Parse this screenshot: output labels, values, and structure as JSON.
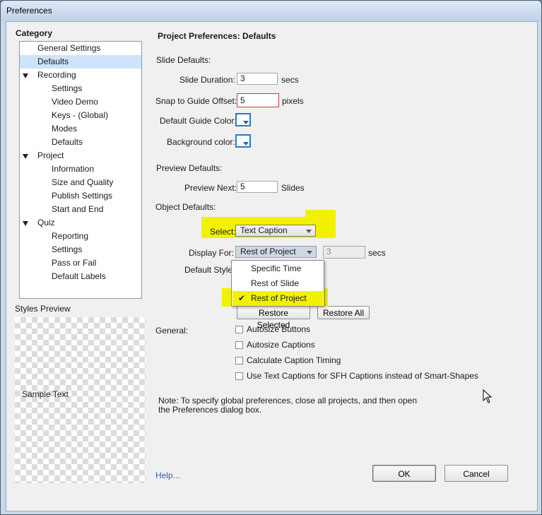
{
  "window": {
    "title": "Preferences"
  },
  "category": {
    "heading": "Category",
    "items": [
      {
        "label": "General Settings"
      },
      {
        "label": "Defaults"
      },
      {
        "label": "Recording"
      },
      {
        "label": "Settings"
      },
      {
        "label": "Video Demo"
      },
      {
        "label": "Keys - (Global)"
      },
      {
        "label": "Modes"
      },
      {
        "label": "Defaults"
      },
      {
        "label": "Project"
      },
      {
        "label": "Information"
      },
      {
        "label": "Size and Quality"
      },
      {
        "label": "Publish Settings"
      },
      {
        "label": "Start and End"
      },
      {
        "label": "Quiz"
      },
      {
        "label": "Reporting"
      },
      {
        "label": "Settings"
      },
      {
        "label": "Pass or Fail"
      },
      {
        "label": "Default Labels"
      }
    ]
  },
  "styles_preview": {
    "heading": "Styles Preview",
    "sample_text": "Sample Text"
  },
  "panel": {
    "title": "Project Preferences: Defaults",
    "slide_defaults": {
      "heading": "Slide Defaults:",
      "slide_duration_label": "Slide Duration:",
      "slide_duration_value": "3",
      "slide_duration_unit": "secs",
      "snap_label": "Snap to Guide Offset:",
      "snap_value": "5",
      "snap_unit": "pixels",
      "guide_color_label": "Default Guide Color:",
      "bg_color_label": "Background color:"
    },
    "preview_defaults": {
      "heading": "Preview Defaults:",
      "preview_next_label": "Preview Next:",
      "preview_next_value": "5",
      "preview_next_unit": "Slides"
    },
    "object_defaults": {
      "heading": "Object Defaults:",
      "select_label": "Select:",
      "select_value": "Text Caption",
      "display_for_label": "Display For:",
      "display_for_value": "Rest of Project",
      "display_for_secs_value": "3",
      "display_for_secs_unit": "secs",
      "default_style_label": "Default Style:",
      "dropdown_options": [
        "Specific Time",
        "Rest of Slide",
        "Rest of Project"
      ],
      "checked_option": "✔",
      "restore_selected": "Restore Selected",
      "restore_all": "Restore All"
    },
    "general": {
      "heading": "General:",
      "checkboxes": [
        {
          "label": "Autosize Buttons",
          "checked": false
        },
        {
          "label": "Autosize Captions",
          "checked": false
        },
        {
          "label": "Calculate Caption Timing",
          "checked": false
        },
        {
          "label": "Use Text Captions for SFH Captions instead of Smart-Shapes",
          "checked": false
        }
      ]
    },
    "note_line1": "Note: To specify global preferences, close all projects, and then open",
    "note_line2": "the Preferences dialog box."
  },
  "footer": {
    "help": "Help...",
    "ok": "OK",
    "cancel": "Cancel"
  },
  "colors": {
    "highlight": "#f2f200",
    "selection": "#cde3fb",
    "link": "#2a62b8"
  }
}
